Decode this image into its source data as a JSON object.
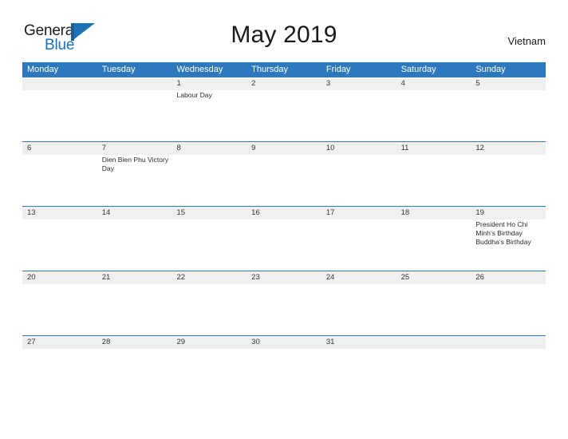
{
  "brand": {
    "name_line1": "General",
    "name_line2": "Blue",
    "mark_icon": "flag-triangle-icon",
    "color_primary": "#1573bd",
    "color_dark": "#1a5e97"
  },
  "header": {
    "title": "May 2019",
    "country": "Vietnam"
  },
  "calendar": {
    "header_bg": "#2e78bd",
    "date_band_bg": "#f0f0f0",
    "separator_color": "#2e78bd",
    "weekdays": [
      "Monday",
      "Tuesday",
      "Wednesday",
      "Thursday",
      "Friday",
      "Saturday",
      "Sunday"
    ],
    "weeks": [
      {
        "days": [
          {
            "date": "",
            "events": ""
          },
          {
            "date": "",
            "events": ""
          },
          {
            "date": "1",
            "events": "Labour Day"
          },
          {
            "date": "2",
            "events": ""
          },
          {
            "date": "3",
            "events": ""
          },
          {
            "date": "4",
            "events": ""
          },
          {
            "date": "5",
            "events": ""
          }
        ]
      },
      {
        "days": [
          {
            "date": "6",
            "events": ""
          },
          {
            "date": "7",
            "events": "Dien Bien Phu Victory Day"
          },
          {
            "date": "8",
            "events": ""
          },
          {
            "date": "9",
            "events": ""
          },
          {
            "date": "10",
            "events": ""
          },
          {
            "date": "11",
            "events": ""
          },
          {
            "date": "12",
            "events": ""
          }
        ]
      },
      {
        "days": [
          {
            "date": "13",
            "events": ""
          },
          {
            "date": "14",
            "events": ""
          },
          {
            "date": "15",
            "events": ""
          },
          {
            "date": "16",
            "events": ""
          },
          {
            "date": "17",
            "events": ""
          },
          {
            "date": "18",
            "events": ""
          },
          {
            "date": "19",
            "events": "President Ho Chi Minh's Birthday  Buddha's Birthday"
          }
        ]
      },
      {
        "days": [
          {
            "date": "20",
            "events": ""
          },
          {
            "date": "21",
            "events": ""
          },
          {
            "date": "22",
            "events": ""
          },
          {
            "date": "23",
            "events": ""
          },
          {
            "date": "24",
            "events": ""
          },
          {
            "date": "25",
            "events": ""
          },
          {
            "date": "26",
            "events": ""
          }
        ]
      },
      {
        "days": [
          {
            "date": "27",
            "events": ""
          },
          {
            "date": "28",
            "events": ""
          },
          {
            "date": "29",
            "events": ""
          },
          {
            "date": "30",
            "events": ""
          },
          {
            "date": "31",
            "events": ""
          },
          {
            "date": "",
            "events": ""
          },
          {
            "date": "",
            "events": ""
          }
        ]
      }
    ]
  }
}
